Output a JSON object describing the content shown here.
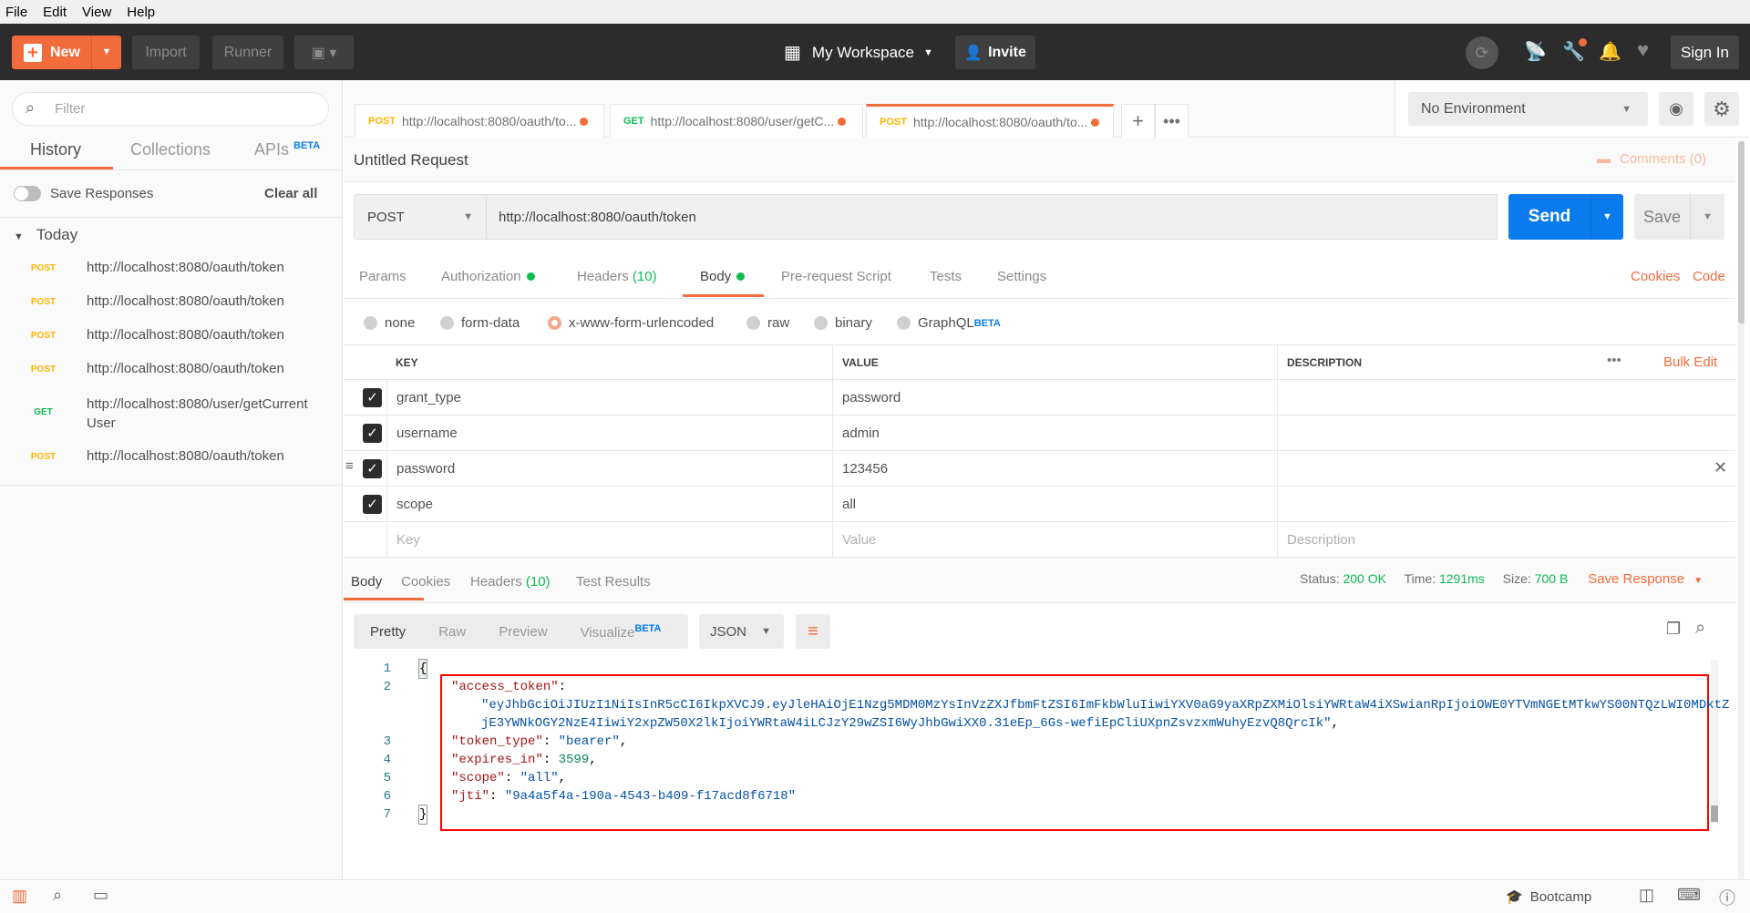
{
  "menu": [
    "File",
    "Edit",
    "View",
    "Help"
  ],
  "header": {
    "new": "New",
    "import": "Import",
    "runner": "Runner",
    "workspace": "My Workspace",
    "invite": "Invite",
    "sign_in": "Sign In"
  },
  "sidebar": {
    "filter_placeholder": "Filter",
    "tabs": [
      "History",
      "Collections",
      "APIs"
    ],
    "beta": "BETA",
    "save_responses": "Save Responses",
    "clear_all": "Clear all",
    "group": "Today",
    "items": [
      {
        "method": "POST",
        "url": "http://localhost:8080/oauth/token"
      },
      {
        "method": "POST",
        "url": "http://localhost:8080/oauth/token"
      },
      {
        "method": "POST",
        "url": "http://localhost:8080/oauth/token"
      },
      {
        "method": "POST",
        "url": "http://localhost:8080/oauth/token"
      },
      {
        "method": "GET",
        "url": "http://localhost:8080/user/getCurrent",
        "url2": "User"
      },
      {
        "method": "POST",
        "url": "http://localhost:8080/oauth/token"
      }
    ]
  },
  "tabs": [
    {
      "method": "POST",
      "url": "http://localhost:8080/oauth/to..."
    },
    {
      "method": "GET",
      "url": "http://localhost:8080/user/getC..."
    },
    {
      "method": "POST",
      "url": "http://localhost:8080/oauth/to..."
    }
  ],
  "environment": "No Environment",
  "request": {
    "title": "Untitled Request",
    "comments": "Comments (0)",
    "method": "POST",
    "url": "http://localhost:8080/oauth/token",
    "send": "Send",
    "save": "Save",
    "tabs": {
      "params": "Params",
      "authorization": "Authorization",
      "headers": "Headers",
      "headers_count": "(10)",
      "body": "Body",
      "prerequest": "Pre-request Script",
      "tests": "Tests",
      "settings": "Settings"
    },
    "cookies": "Cookies",
    "code": "Code",
    "body_modes": [
      "none",
      "form-data",
      "x-www-form-urlencoded",
      "raw",
      "binary",
      "GraphQL"
    ],
    "selected_mode": "x-www-form-urlencoded",
    "table": {
      "headers": [
        "KEY",
        "VALUE",
        "DESCRIPTION"
      ],
      "bulk_edit": "Bulk Edit",
      "rows": [
        {
          "key": "grant_type",
          "value": "password",
          "checked": true
        },
        {
          "key": "username",
          "value": "admin",
          "checked": true
        },
        {
          "key": "password",
          "value": "123456",
          "checked": true
        },
        {
          "key": "scope",
          "value": "all",
          "checked": true
        }
      ],
      "placeholder": {
        "key": "Key",
        "value": "Value",
        "description": "Description"
      }
    }
  },
  "response": {
    "tabs": {
      "body": "Body",
      "cookies": "Cookies",
      "headers": "Headers",
      "headers_count": "(10)",
      "tests": "Test Results"
    },
    "status_label": "Status:",
    "status": "200 OK",
    "time_label": "Time:",
    "time": "1291ms",
    "size_label": "Size:",
    "size": "700 B",
    "save_response": "Save Response",
    "views": [
      "Pretty",
      "Raw",
      "Preview",
      "Visualize"
    ],
    "format": "JSON",
    "lines": {
      "l1": "{",
      "l2k": "\"access_token\"",
      "l2c": ":",
      "l2a": "\"eyJhbGciOiJIUzI1NiIsInR5cCI6IkpXVCJ9.eyJleHAiOjE1Nzg5MDM0MzYsInVzZXJfbmFtZSI6ImFkbWluIiwiYXV0aG9yaXRpZXMiOlsiYWRtaW4iXSwianRpIjoiOWE0YTVmNGEtMTkwYS00NTQzLWI0MDktZ",
      "l2b": "jE3YWNkOGY2NzE4IiwiY2xpZW50X2lkIjoiYWRtaW4iLCJzY29wZSI6WyJhbGwiXX0.31eEp_6Gs-wefiEpCliUXpnZsvzxmWuhyEzvQ8QrcIk\"",
      "l3k": "\"token_type\"",
      "l3v": "\"bearer\"",
      "l4k": "\"expires_in\"",
      "l4v": "3599",
      "l5k": "\"scope\"",
      "l5v": "\"all\"",
      "l6k": "\"jti\"",
      "l6v": "\"9a4a5f4a-190a-4543-b409-f17acd8f6718\"",
      "l7": "}"
    }
  },
  "statusbar": {
    "bootcamp": "Bootcamp"
  },
  "colors": {
    "accent": "#f26b3a",
    "send": "#097bed",
    "highlight_box": "#ff0000"
  }
}
